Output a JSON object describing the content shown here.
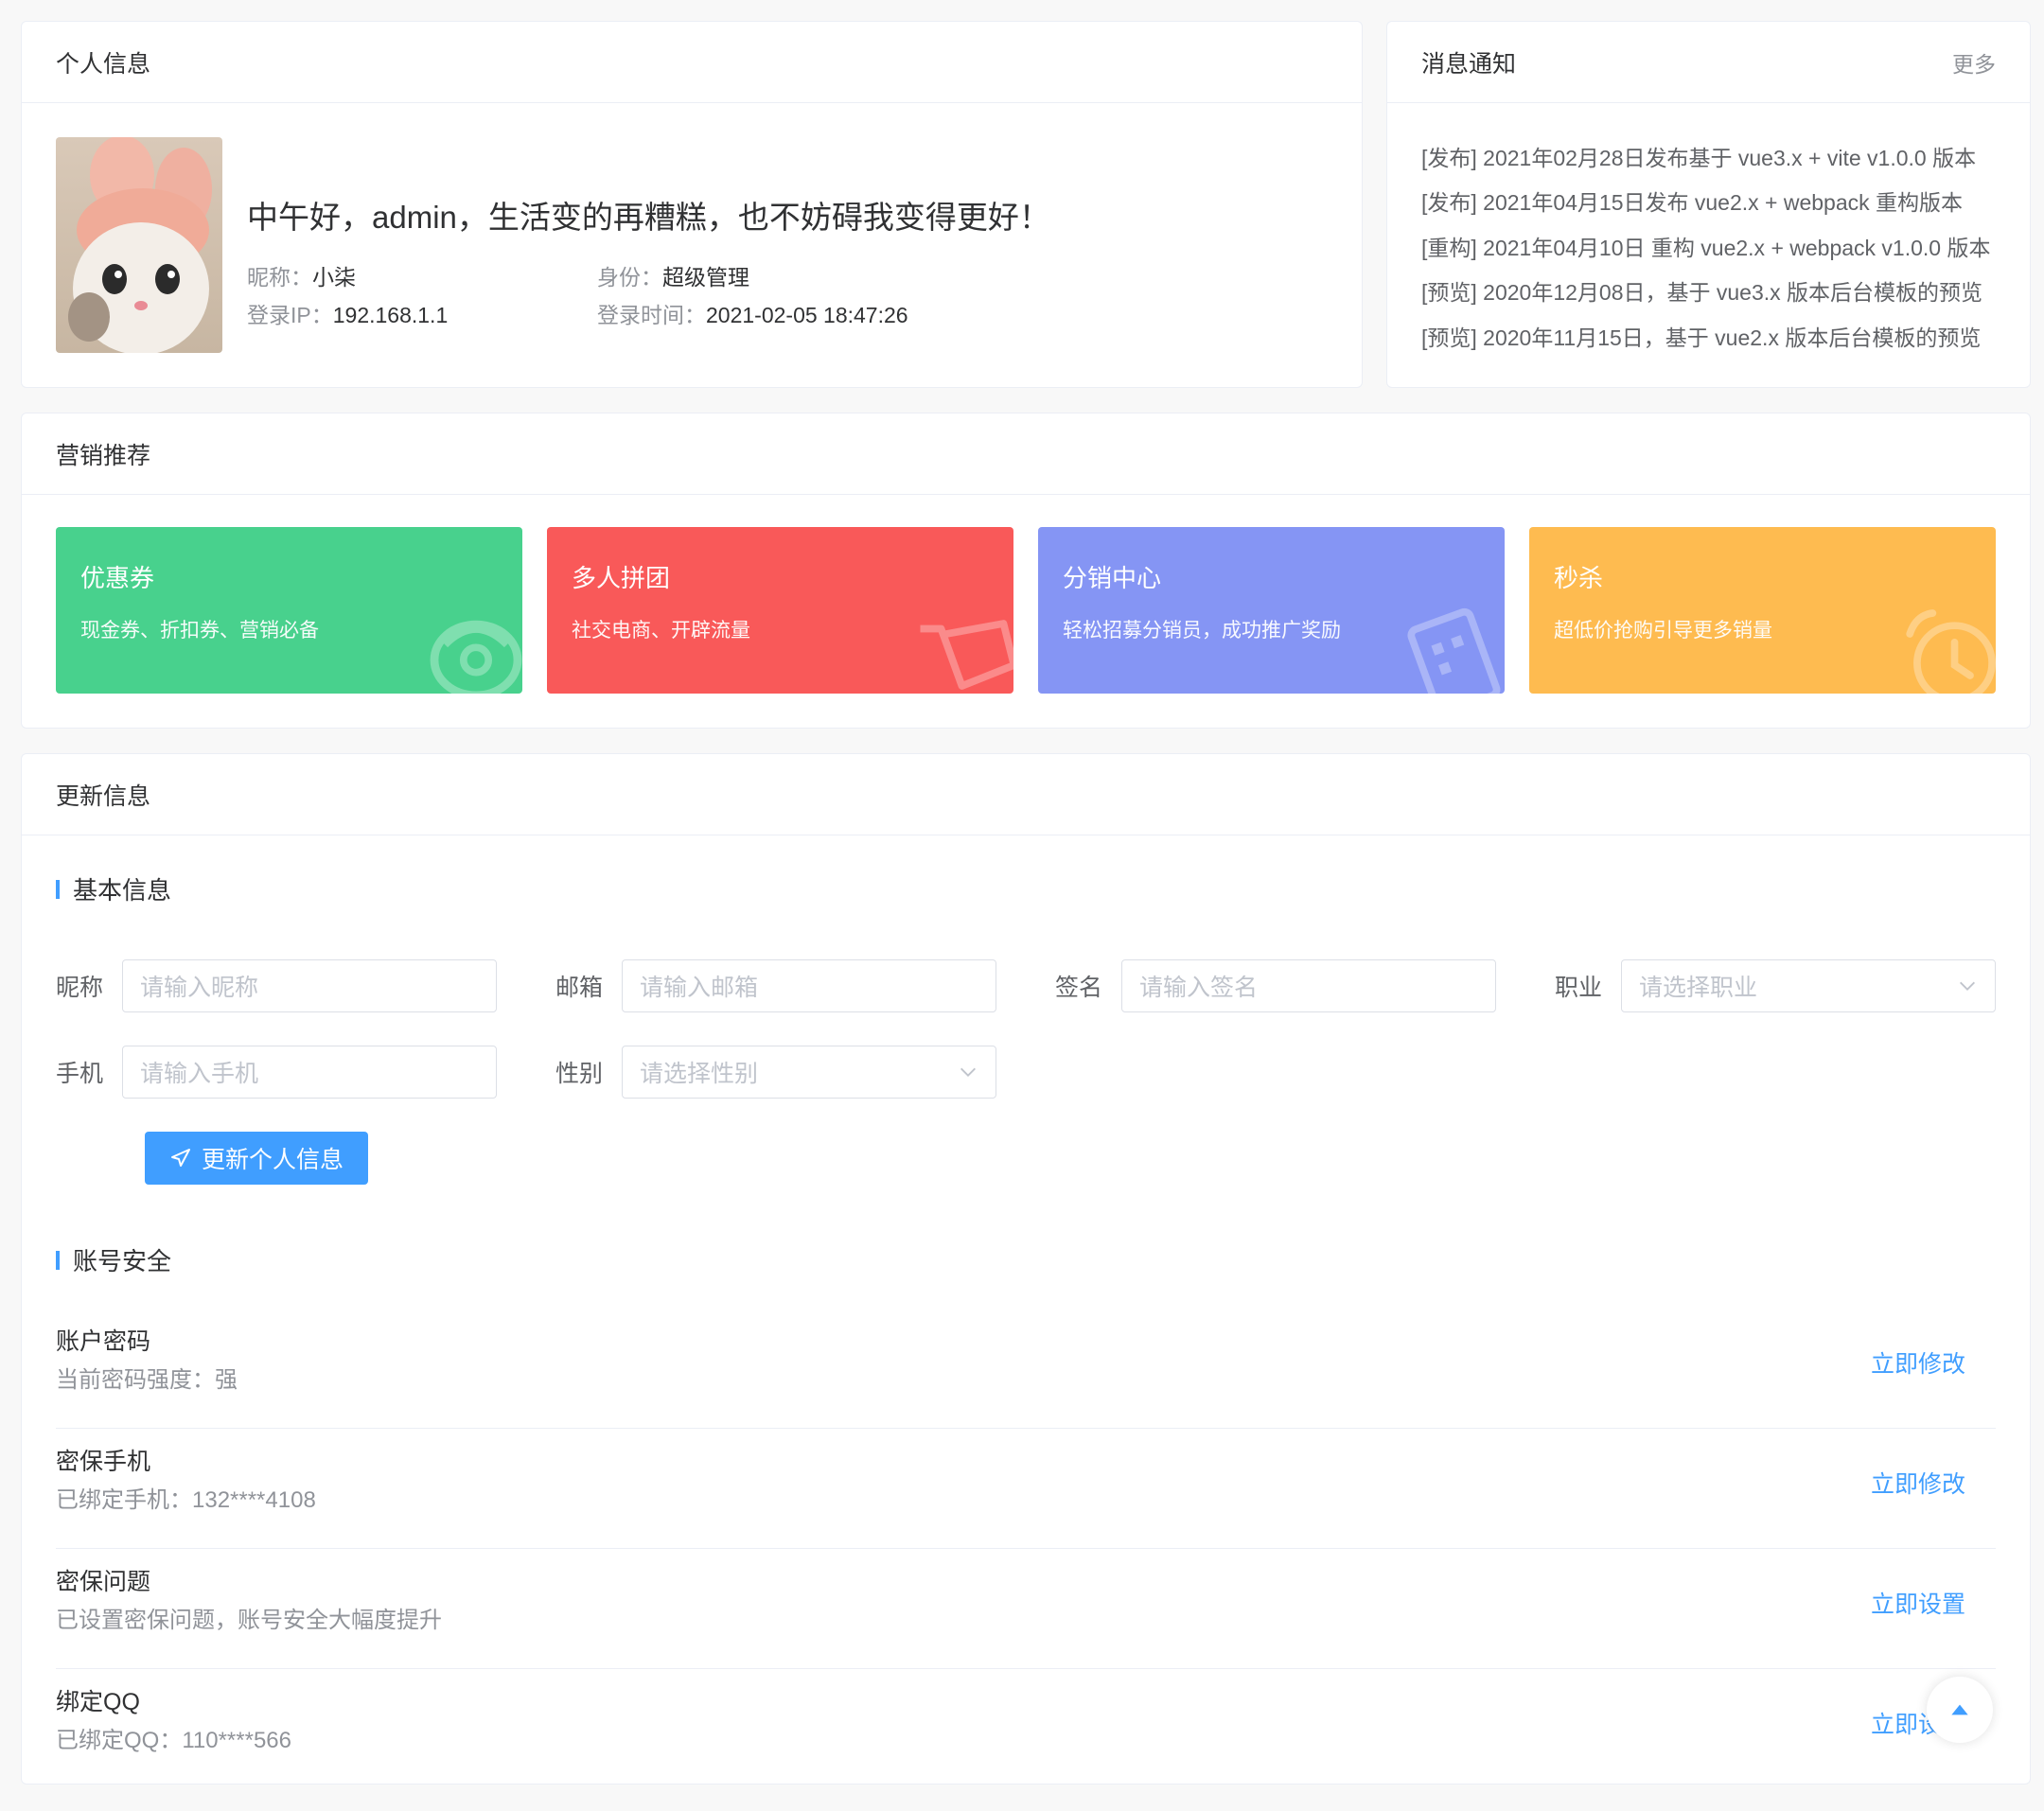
{
  "personal": {
    "title": "个人信息",
    "greeting": "中午好，admin，生活变的再糟糕，也不妨碍我变得更好！",
    "nickname_label": "昵称：",
    "nickname": "小柒",
    "role_label": "身份：",
    "role": "超级管理",
    "ip_label": "登录IP：",
    "ip": "192.168.1.1",
    "time_label": "登录时间：",
    "time": "2021-02-05 18:47:26"
  },
  "notices": {
    "title": "消息通知",
    "more": "更多",
    "items": [
      "[发布] 2021年02月28日发布基于 vue3.x + vite v1.0.0 版本",
      "[发布] 2021年04月15日发布 vue2.x + webpack 重构版本",
      "[重构] 2021年04月10日 重构 vue2.x + webpack v1.0.0 版本",
      "[预览] 2020年12月08日，基于 vue3.x 版本后台模板的预览",
      "[预览] 2020年11月15日，基于 vue2.x 版本后台模板的预览"
    ]
  },
  "marketing": {
    "title": "营销推荐",
    "items": [
      {
        "title": "优惠券",
        "desc": "现金券、折扣券、营销必备",
        "color": "#48d18d",
        "icon": "wallet-icon"
      },
      {
        "title": "多人拼团",
        "desc": "社交电商、开辟流量",
        "color": "#f95959",
        "icon": "cart-icon"
      },
      {
        "title": "分销中心",
        "desc": "轻松招募分销员，成功推广奖励",
        "color": "#8595f4",
        "icon": "building-icon"
      },
      {
        "title": "秒杀",
        "desc": "超低价抢购引导更多销量",
        "color": "#febb50",
        "icon": "alarm-clock-icon"
      }
    ]
  },
  "update": {
    "title": "更新信息",
    "basic_title": "基本信息",
    "fields": {
      "nickname": {
        "label": "昵称",
        "placeholder": "请输入昵称"
      },
      "email": {
        "label": "邮箱",
        "placeholder": "请输入邮箱"
      },
      "signature": {
        "label": "签名",
        "placeholder": "请输入签名"
      },
      "job": {
        "label": "职业",
        "placeholder": "请选择职业"
      },
      "phone": {
        "label": "手机",
        "placeholder": "请输入手机"
      },
      "gender": {
        "label": "性别",
        "placeholder": "请选择性别"
      }
    },
    "submit": "更新个人信息",
    "security_title": "账号安全",
    "security": [
      {
        "title": "账户密码",
        "desc": "当前密码强度：强",
        "action": "立即修改"
      },
      {
        "title": "密保手机",
        "desc": "已绑定手机：132****4108",
        "action": "立即修改"
      },
      {
        "title": "密保问题",
        "desc": "已设置密保问题，账号安全大幅度提升",
        "action": "立即设置"
      },
      {
        "title": "绑定QQ",
        "desc": "已绑定QQ：110****566",
        "action": "立即设置"
      }
    ]
  },
  "colors": {
    "primary": "#409eff",
    "page_bg": "#f8f8f8"
  }
}
